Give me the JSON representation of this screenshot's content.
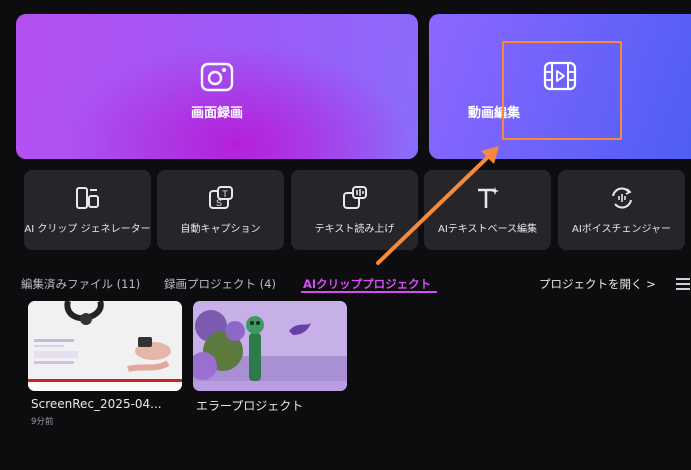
{
  "hero": {
    "record_label": "画面録画",
    "edit_label": "動画編集"
  },
  "tools": [
    {
      "label": "AI クリップ ジェネレーター",
      "icon": "clip-generator-icon"
    },
    {
      "label": "自動キャプション",
      "icon": "caption-icon"
    },
    {
      "label": "テキスト読み上げ",
      "icon": "text-to-speech-icon"
    },
    {
      "label": "AIテキストベース編集",
      "icon": "text-edit-icon"
    },
    {
      "label": "AIボイスチェンジャー",
      "icon": "voice-changer-icon"
    }
  ],
  "tabs": {
    "edited": "編集済みファイル (11)",
    "recorded": "録画プロジェクト (4)",
    "ai_clip": "AIクリッププロジェクト"
  },
  "open_project": "プロジェクトを開く >",
  "projects": [
    {
      "title": "ScreenRec_2025-04...",
      "time": "9分前"
    },
    {
      "title": "エラープロジェクト"
    }
  ],
  "colors": {
    "accent": "#d64ef2",
    "highlight": "#f58a3c",
    "background": "#0d0d10",
    "tool_bg": "#25252a"
  }
}
